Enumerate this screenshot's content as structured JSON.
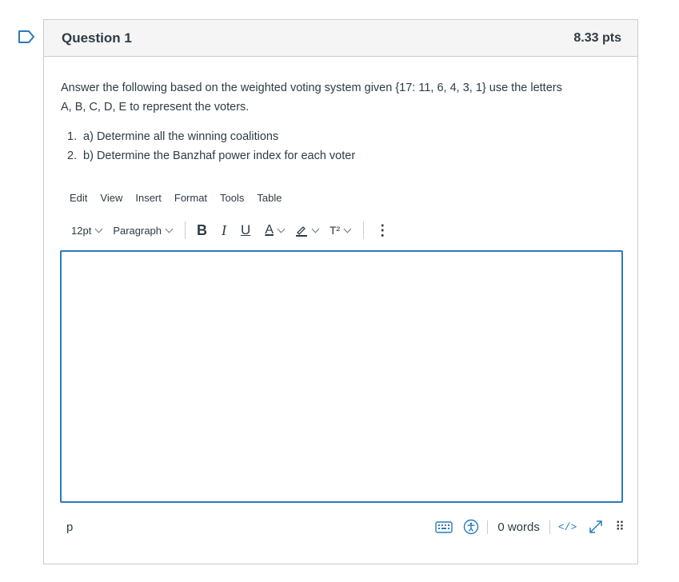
{
  "question": {
    "title": "Question 1",
    "points": "8.33 pts",
    "prompt_line1": "Answer the following based on the weighted voting system given {17: 11, 6, 4, 3, 1} use the letters",
    "prompt_line2": "A, B, C, D, E to represent the voters.",
    "items": [
      {
        "num": "1.",
        "text": "a) Determine all the winning coalitions"
      },
      {
        "num": "2.",
        "text": "b) Determine the Banzhaf power index for each voter"
      }
    ]
  },
  "editor": {
    "menu": [
      "Edit",
      "View",
      "Insert",
      "Format",
      "Tools",
      "Table"
    ],
    "font_size": "12pt",
    "block_format": "Paragraph",
    "bold": "B",
    "italic": "I",
    "underline": "U",
    "text_color": "A",
    "superscript": "T²",
    "more": "⋮",
    "path": "p",
    "word_count": "0 words",
    "html_toggle": "</>",
    "drag_handle": "⠿"
  },
  "colors": {
    "accent": "#2b7abc",
    "border": "#c7cdd1",
    "text": "#2d3b45",
    "header_bg": "#f5f5f5"
  }
}
